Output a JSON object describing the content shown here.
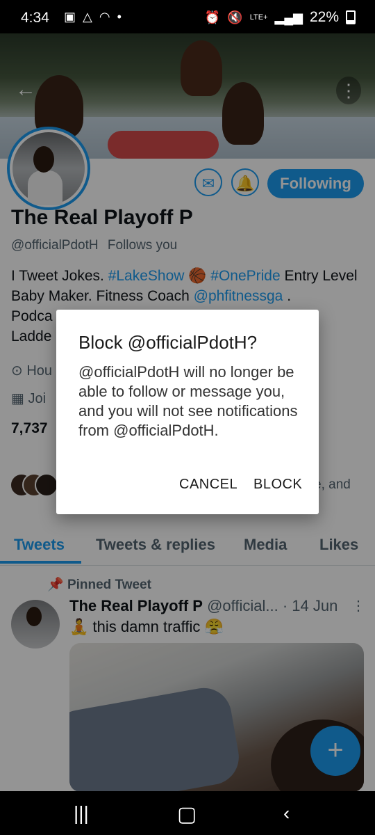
{
  "status_bar": {
    "time": "4:34",
    "lte": "LTE+",
    "battery": "22%"
  },
  "profile": {
    "display_name": "The Real Playoff P",
    "handle": "@officialPdotH",
    "follows_you": "Follows you",
    "following_button": "Following",
    "bio": {
      "part1": "I Tweet Jokes. ",
      "tag1": "#LakeShow",
      "part2": " 🏀 ",
      "tag2": "#OnePride",
      "part3": " Entry Level Baby Maker. Fitness Coach ",
      "mention": "@phfitnessga",
      "part4": " .",
      "line3": "Podca",
      "line4": "Ladde"
    },
    "location_partial": "Hou",
    "joined_partial": "Joi",
    "count_partial": "7,737",
    "known_followers_partial": "e, and"
  },
  "tabs": [
    {
      "label": "Tweets"
    },
    {
      "label": "Tweets & replies"
    },
    {
      "label": "Media"
    },
    {
      "label": "Likes"
    }
  ],
  "pinned": {
    "label": "Pinned Tweet",
    "name": "The Real Playoff P",
    "handle": "@official...",
    "date": "· 14 Jun",
    "text": "🧘 this damn traffic 😤"
  },
  "dialog": {
    "title": "Block @officialPdotH?",
    "body": "@officialPdotH will no longer be able to follow or message you, and you will not see notifications from @officialPdotH.",
    "cancel": "CANCEL",
    "block": "BLOCK"
  },
  "colors": {
    "accent": "#1d9bf0",
    "overlay": "rgba(0,0,0,0.42)"
  },
  "icons": [
    "back-arrow-icon",
    "more-icon",
    "mail-icon",
    "notification-bell-icon",
    "location-icon",
    "calendar-icon",
    "pin-icon",
    "compose-icon",
    "recents-icon",
    "home-icon",
    "back-icon"
  ]
}
